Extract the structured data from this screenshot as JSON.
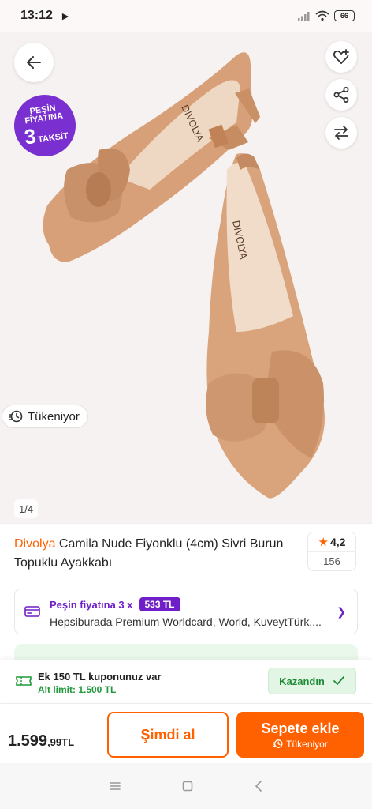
{
  "status_bar": {
    "time": "13:12",
    "battery": "66"
  },
  "gallery": {
    "promo_badge": {
      "line1": "PEŞİN",
      "line2": "FİYATINA",
      "number": "3",
      "word": "TAKSİT"
    },
    "stock_chip": "Tükeniyor",
    "page_indicator": "1/4",
    "shoe_color": "#d9a37c",
    "shoe_brand_print": "DIVOLYA"
  },
  "product": {
    "brand": "Divolya",
    "title": "Camila Nude Fiyonklu (4cm) Sivri Burun Topuklu Ayakkabı",
    "rating": "4,2",
    "review_count": "156"
  },
  "installment": {
    "label": "Peşin fiyatına 3 x",
    "amount": "533 TL",
    "cards": "Hepsiburada Premium Worldcard, World, KuveytTürk,..."
  },
  "coupon": {
    "title": "Ek 150 TL kuponunuz var",
    "limit": "Alt limit: 1.500 TL",
    "button": "Kazandın"
  },
  "buy_bar": {
    "price_int": "1.599",
    "price_dec": ",99TL",
    "buy_now": "Şimdi al",
    "add_to_cart": "Sepete ekle",
    "add_to_cart_sub": "Tükeniyor"
  },
  "colors": {
    "accent": "#ff6000",
    "purple": "#6f1fc7",
    "green": "#1f9a3a"
  }
}
